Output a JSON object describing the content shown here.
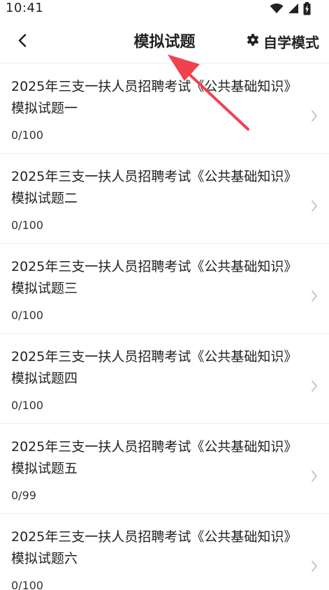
{
  "status_bar": {
    "time": "10:41",
    "icons": [
      "wifi-icon",
      "cell-signal-icon",
      "battery-charging-icon"
    ]
  },
  "header": {
    "title": "模拟试题",
    "back_icon": "chevron-left-icon",
    "self_study_label": "自学模式",
    "self_study_icon": "gear-icon"
  },
  "exams": [
    {
      "title": "2025年三支一扶人员招聘考试《公共基础知识》模拟试题一",
      "score": "0/100"
    },
    {
      "title": "2025年三支一扶人员招聘考试《公共基础知识》模拟试题二",
      "score": "0/100"
    },
    {
      "title": "2025年三支一扶人员招聘考试《公共基础知识》模拟试题三",
      "score": "0/100"
    },
    {
      "title": "2025年三支一扶人员招聘考试《公共基础知识》模拟试题四",
      "score": "0/100"
    },
    {
      "title": "2025年三支一扶人员招聘考试《公共基础知识》模拟试题五",
      "score": "0/99"
    },
    {
      "title": "2025年三支一扶人员招聘考试《公共基础知识》模拟试题六",
      "score": "0/100"
    }
  ],
  "colors": {
    "annotation_arrow": "#f0424e",
    "chevron": "#c4c4c4",
    "divider": "#efefef"
  }
}
